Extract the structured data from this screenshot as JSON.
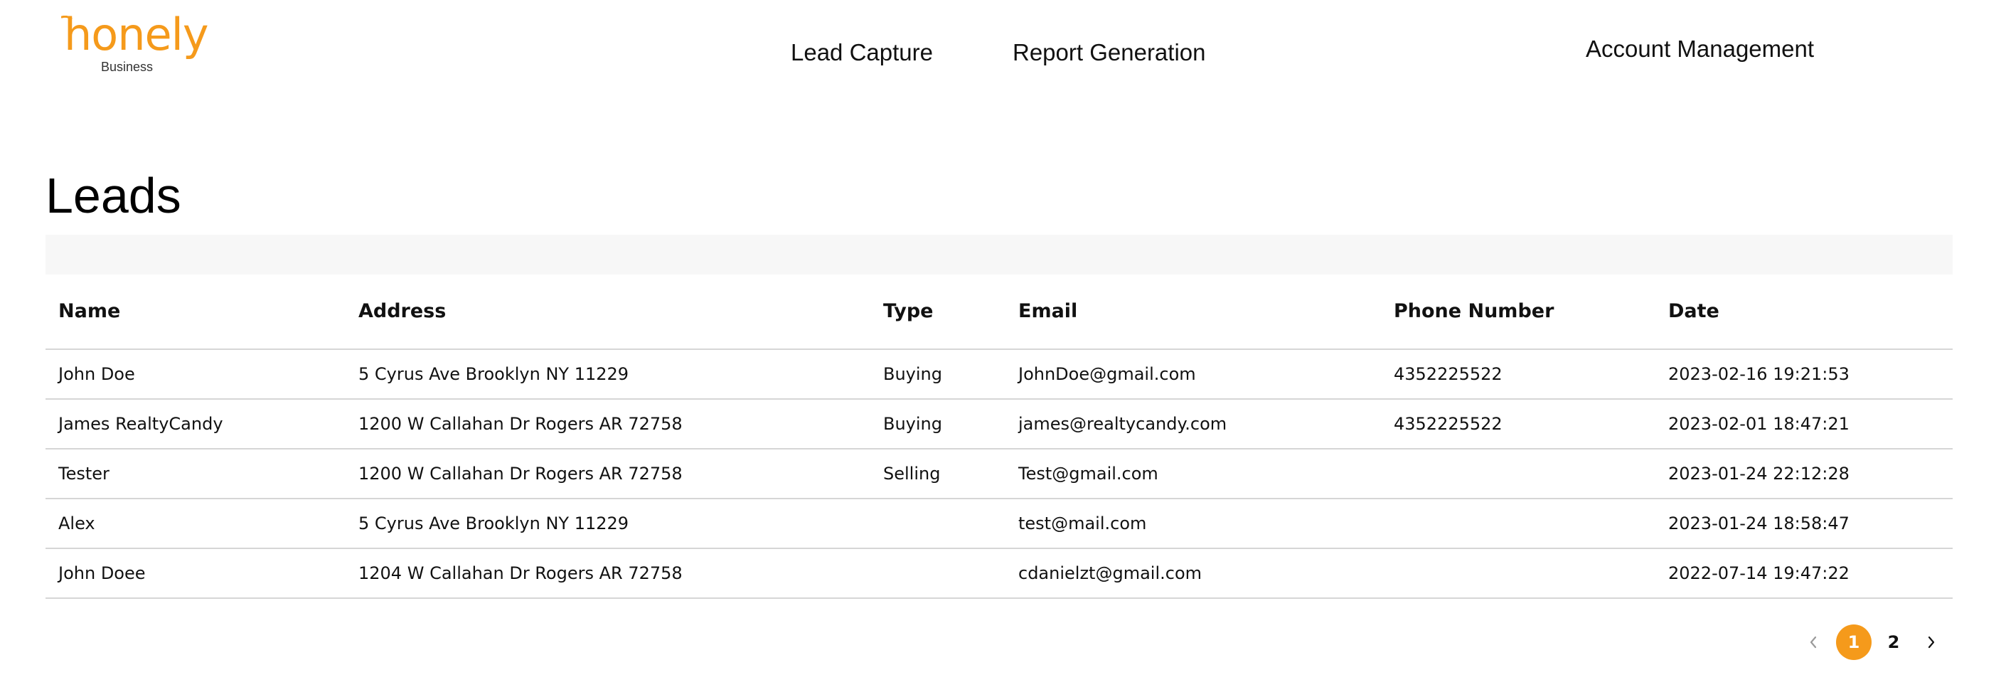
{
  "header": {
    "logo_word": "honely",
    "logo_sub": "Business",
    "nav": {
      "lead_capture": "Lead Capture",
      "report_generation": "Report Generation",
      "account_management": "Account Management"
    }
  },
  "main": {
    "title": "Leads",
    "table": {
      "columns": [
        "Name",
        "Address",
        "Type",
        "Email",
        "Phone Number",
        "Date"
      ],
      "rows": [
        {
          "name": "John Doe",
          "address": "5 Cyrus Ave Brooklyn NY 11229",
          "type": "Buying",
          "email": "JohnDoe@gmail.com",
          "phone": "4352225522",
          "date": "2023-02-16 19:21:53"
        },
        {
          "name": "James RealtyCandy",
          "address": "1200 W Callahan Dr Rogers AR 72758",
          "type": "Buying",
          "email": "james@realtycandy.com",
          "phone": "4352225522",
          "date": "2023-02-01 18:47:21"
        },
        {
          "name": "Tester",
          "address": "1200 W Callahan Dr Rogers AR 72758",
          "type": "Selling",
          "email": "Test@gmail.com",
          "phone": "",
          "date": "2023-01-24 22:12:28"
        },
        {
          "name": "Alex",
          "address": "5 Cyrus Ave Brooklyn NY 11229",
          "type": "",
          "email": "test@mail.com",
          "phone": "",
          "date": "2023-01-24 18:58:47"
        },
        {
          "name": "John Doee",
          "address": "1204 W Callahan Dr Rogers AR 72758",
          "type": "",
          "email": "cdanielzt@gmail.com",
          "phone": "",
          "date": "2022-07-14 19:47:22"
        }
      ]
    },
    "pagination": {
      "pages": [
        "1",
        "2"
      ],
      "current": "1",
      "prev_icon": "chevron-left-icon",
      "next_icon": "chevron-right-icon"
    }
  },
  "colors": {
    "brand": "#f59a1b",
    "band": "#f7f7f7",
    "divider": "#d6d6d6"
  }
}
